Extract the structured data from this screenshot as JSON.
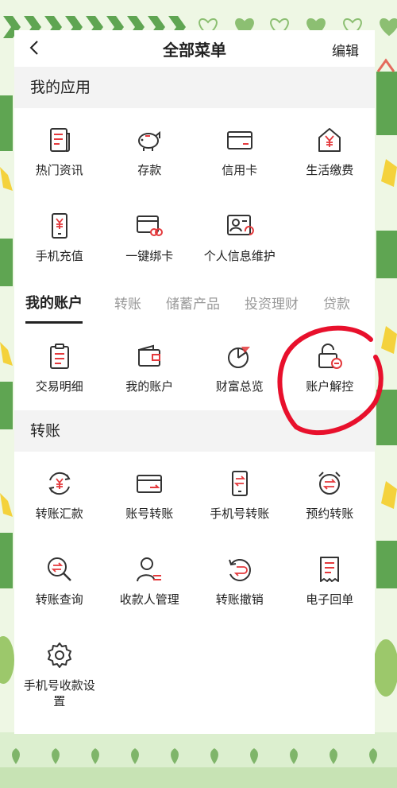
{
  "header": {
    "title": "全部菜单",
    "edit_label": "编辑"
  },
  "my_apps": {
    "title": "我的应用",
    "items": [
      {
        "label": "热门资讯",
        "icon": "news-icon"
      },
      {
        "label": "存款",
        "icon": "piggy-bank-icon"
      },
      {
        "label": "信用卡",
        "icon": "credit-card-icon"
      },
      {
        "label": "生活缴费",
        "icon": "home-payment-icon"
      },
      {
        "label": "手机充值",
        "icon": "phone-topup-icon"
      },
      {
        "label": "一键绑卡",
        "icon": "bind-card-icon"
      },
      {
        "label": "个人信息维护",
        "icon": "profile-card-icon"
      }
    ]
  },
  "tabs": [
    "我的账户",
    "转账",
    "储蓄产品",
    "投资理财",
    "贷款"
  ],
  "account_items": [
    {
      "label": "交易明细",
      "icon": "clipboard-list-icon"
    },
    {
      "label": "我的账户",
      "icon": "wallet-icon"
    },
    {
      "label": "财富总览",
      "icon": "pie-chart-icon"
    },
    {
      "label": "账户解控",
      "icon": "unlock-icon"
    }
  ],
  "transfer": {
    "title": "转账",
    "items": [
      {
        "label": "转账汇款",
        "icon": "currency-exchange-icon"
      },
      {
        "label": "账号转账",
        "icon": "card-transfer-icon"
      },
      {
        "label": "手机号转账",
        "icon": "phone-transfer-icon"
      },
      {
        "label": "预约转账",
        "icon": "alarm-transfer-icon"
      },
      {
        "label": "转账查询",
        "icon": "search-transfer-icon"
      },
      {
        "label": "收款人管理",
        "icon": "payee-icon"
      },
      {
        "label": "转账撤销",
        "icon": "undo-transfer-icon"
      },
      {
        "label": "电子回单",
        "icon": "receipt-icon"
      },
      {
        "label": "手机号收款设置",
        "icon": "settings-gear-icon"
      }
    ]
  },
  "colors": {
    "accent": "#e4393c",
    "annotation": "#e8102c",
    "frame_green": "#7fb56a"
  }
}
